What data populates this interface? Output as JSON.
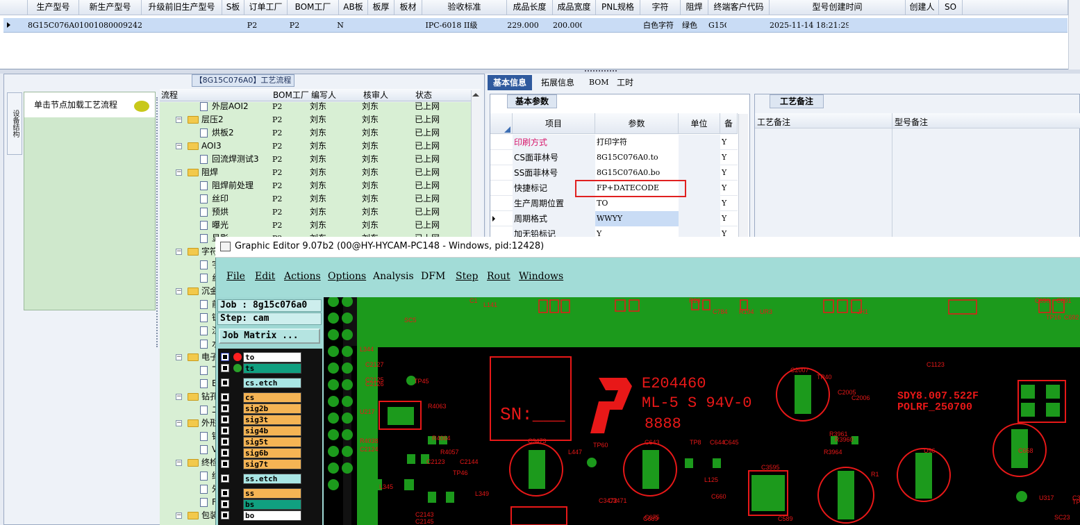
{
  "top_grid": {
    "headers": [
      "生产型号",
      "新生产型号",
      "升级前旧生产型号",
      "S板",
      "订单工厂",
      "BOM工厂",
      "AB板",
      "板厚",
      "板材",
      "验收标准",
      "成品长度",
      "成品宽度",
      "PNL规格",
      "字符",
      "阻焊",
      "终端客户代码",
      "型号创建时间",
      "创建人",
      "SO"
    ],
    "row": [
      "8G15C076A0",
      "10010800092420",
      "",
      "",
      "P2",
      "P2",
      "N",
      "",
      "",
      "IPC-6018 II级",
      "229.000",
      "200.000",
      "",
      "白色字符",
      "绿色",
      "G15C",
      "2025-11-14 18:21:29",
      "",
      ""
    ]
  },
  "flow_panel": {
    "title": "【8G15C076A0】工艺流程",
    "side_tab": "设备结构",
    "load_hint": "单击节点加载工艺流程",
    "columns": [
      "流程",
      "BOM工厂",
      "编写人",
      "核审人",
      "状态"
    ],
    "rows": [
      {
        "name": "外层AOI2",
        "kind": "doc",
        "bom": "P2",
        "writer": "刘东",
        "reviewer": "刘东",
        "status": "已上网"
      },
      {
        "name": "层压2",
        "kind": "folder",
        "bom": "P2",
        "writer": "刘东",
        "reviewer": "刘东",
        "status": "已上网"
      },
      {
        "name": "烘板2",
        "kind": "doc",
        "bom": "P2",
        "writer": "刘东",
        "reviewer": "刘东",
        "status": "已上网"
      },
      {
        "name": "AOI3",
        "kind": "folder",
        "bom": "P2",
        "writer": "刘东",
        "reviewer": "刘东",
        "status": "已上网"
      },
      {
        "name": "回流焊测试3",
        "kind": "doc",
        "bom": "P2",
        "writer": "刘东",
        "reviewer": "刘东",
        "status": "已上网"
      },
      {
        "name": "阻焊",
        "kind": "folder",
        "bom": "P2",
        "writer": "刘东",
        "reviewer": "刘东",
        "status": "已上网"
      },
      {
        "name": "阻焊前处理",
        "kind": "doc",
        "bom": "P2",
        "writer": "刘东",
        "reviewer": "刘东",
        "status": "已上网"
      },
      {
        "name": "丝印",
        "kind": "doc",
        "bom": "P2",
        "writer": "刘东",
        "reviewer": "刘东",
        "status": "已上网"
      },
      {
        "name": "预烘",
        "kind": "doc",
        "bom": "P2",
        "writer": "刘东",
        "reviewer": "刘东",
        "status": "已上网"
      },
      {
        "name": "曝光",
        "kind": "doc",
        "bom": "P2",
        "writer": "刘东",
        "reviewer": "刘东",
        "status": "已上网"
      },
      {
        "name": "显影",
        "kind": "doc",
        "bom": "P2",
        "writer": "刘东",
        "reviewer": "刘东",
        "status": "已上网"
      },
      {
        "name": "字符",
        "kind": "folder",
        "bom": "",
        "writer": "",
        "reviewer": "",
        "status": ""
      },
      {
        "name": "字",
        "kind": "doc",
        "bom": "",
        "writer": "",
        "reviewer": "",
        "status": ""
      },
      {
        "name": "丝",
        "kind": "doc",
        "bom": "",
        "writer": "",
        "reviewer": "",
        "status": ""
      },
      {
        "name": "沉金",
        "kind": "folder",
        "bom": "",
        "writer": "",
        "reviewer": "",
        "status": ""
      },
      {
        "name": "前",
        "kind": "doc",
        "bom": "",
        "writer": "",
        "reviewer": "",
        "status": ""
      },
      {
        "name": "镀",
        "kind": "doc",
        "bom": "",
        "writer": "",
        "reviewer": "",
        "status": ""
      },
      {
        "name": "沉",
        "kind": "doc",
        "bom": "",
        "writer": "",
        "reviewer": "",
        "status": ""
      },
      {
        "name": "水",
        "kind": "doc",
        "bom": "",
        "writer": "",
        "reviewer": "",
        "status": ""
      },
      {
        "name": "电子",
        "kind": "folder",
        "bom": "",
        "writer": "",
        "reviewer": "",
        "status": ""
      },
      {
        "name": "飞",
        "kind": "doc",
        "bom": "",
        "writer": "",
        "reviewer": "",
        "status": ""
      },
      {
        "name": "E",
        "kind": "doc",
        "bom": "",
        "writer": "",
        "reviewer": "",
        "status": ""
      },
      {
        "name": "钻孔",
        "kind": "folder",
        "bom": "",
        "writer": "",
        "reviewer": "",
        "status": ""
      },
      {
        "name": "二",
        "kind": "doc",
        "bom": "",
        "writer": "",
        "reviewer": "",
        "status": ""
      },
      {
        "name": "外形",
        "kind": "folder",
        "bom": "",
        "writer": "",
        "reviewer": "",
        "status": ""
      },
      {
        "name": "锣",
        "kind": "doc",
        "bom": "",
        "writer": "",
        "reviewer": "",
        "status": ""
      },
      {
        "name": "V",
        "kind": "doc",
        "bom": "",
        "writer": "",
        "reviewer": "",
        "status": ""
      },
      {
        "name": "终检",
        "kind": "folder",
        "bom": "",
        "writer": "",
        "reviewer": "",
        "status": ""
      },
      {
        "name": "终",
        "kind": "doc",
        "bom": "",
        "writer": "",
        "reviewer": "",
        "status": ""
      },
      {
        "name": "外",
        "kind": "doc",
        "bom": "",
        "writer": "",
        "reviewer": "",
        "status": ""
      },
      {
        "name": "FQ",
        "kind": "doc",
        "bom": "",
        "writer": "",
        "reviewer": "",
        "status": ""
      },
      {
        "name": "包装",
        "kind": "folder",
        "bom": "",
        "writer": "",
        "reviewer": "",
        "status": ""
      }
    ]
  },
  "right_tabs": [
    "基本信息",
    "拓展信息",
    "BOM",
    "工时"
  ],
  "basic_params": {
    "title": "基本参数",
    "columns": [
      "项目",
      "参数",
      "单位",
      "备"
    ],
    "rows": [
      {
        "item": "印刷方式",
        "value": "打印字符",
        "unit": "",
        "flag": "Y",
        "highlight": true
      },
      {
        "item": "CS面菲林号",
        "value": "8G15C076A0.to",
        "unit": "",
        "flag": "Y",
        "highlight": false
      },
      {
        "item": "SS面菲林号",
        "value": "8G15C076A0.bo",
        "unit": "",
        "flag": "Y",
        "highlight": false
      },
      {
        "item": "快捷标记",
        "value": "FP+DATECODE",
        "unit": "",
        "flag": "Y",
        "highlight": false
      },
      {
        "item": "生产周期位置",
        "value": "TO",
        "unit": "",
        "flag": "Y",
        "highlight": false
      },
      {
        "item": "周期格式",
        "value": "WWYY",
        "unit": "",
        "flag": "Y",
        "highlight": false
      },
      {
        "item": "加无铅标记",
        "value": "Y",
        "unit": "",
        "flag": "Y",
        "highlight": false
      }
    ]
  },
  "notes": {
    "title": "工艺备注",
    "columns": [
      "工艺备注",
      "型号备注"
    ]
  },
  "graphic_editor": {
    "title": "Graphic Editor 9.07b2 (00@HY-HYCAM-PC148 - Windows, pid:12428)",
    "menu": [
      "File",
      "Edit",
      "Actions",
      "Options",
      "Analysis",
      "DFM",
      "Step",
      "Rout",
      "Windows"
    ],
    "job": "Job : 8g15c076a0",
    "step": "Step: cam",
    "job_matrix": "Job Matrix ...",
    "layers": [
      {
        "name": "to",
        "color": "#ffffff"
      },
      {
        "name": "ts",
        "color": "#10a080"
      },
      {
        "name": "cs.etch",
        "color": "#a9e6e4"
      },
      {
        "name": "cs",
        "color": "#f5b454"
      },
      {
        "name": "sig2b",
        "color": "#f5b454"
      },
      {
        "name": "sig3t",
        "color": "#f5b454"
      },
      {
        "name": "sig4b",
        "color": "#f5b454"
      },
      {
        "name": "sig5t",
        "color": "#f5b454"
      },
      {
        "name": "sig6b",
        "color": "#f5b454"
      },
      {
        "name": "sig7t",
        "color": "#f5b454"
      },
      {
        "name": "ss.etch",
        "color": "#a9e6e4"
      },
      {
        "name": "ss",
        "color": "#f5b454"
      },
      {
        "name": "bs",
        "color": "#10a080"
      },
      {
        "name": "bo",
        "color": "#ffffff"
      }
    ],
    "pcb_labels": {
      "e_number": "E204460",
      "ml": "ML-5 S 94V-0",
      "digits": "8888",
      "sn": "SN:___",
      "sdy": "SDY8.007.522F",
      "polrf": "POLRF_250700",
      "refs": [
        "C691",
        "C690",
        "C692",
        "TP16",
        "JH1",
        "UR3",
        "R194",
        "C784",
        "R20",
        "SC5",
        "L141",
        "C1",
        "L344",
        "C2127",
        "C2125",
        "C2126",
        "TP45",
        "U217",
        "R4063",
        "R4038",
        "C2124",
        "R4064",
        "R4057",
        "C2123",
        "C2144",
        "TP46",
        "L345",
        "L349",
        "C2143",
        "C2145",
        "C3473",
        "L447",
        "TP60",
        "C643",
        "TP8",
        "C644",
        "C645",
        "L125",
        "C3472",
        "C3471",
        "C2007",
        "TP40",
        "C2005",
        "C2006",
        "R3960",
        "R3964",
        "R3961",
        "C689",
        "C668",
        "U96",
        "C3595",
        "C3599",
        "TP63",
        "U317",
        "SC23",
        "C1123",
        "C589",
        "C675",
        "C660",
        "R1"
      ]
    }
  }
}
